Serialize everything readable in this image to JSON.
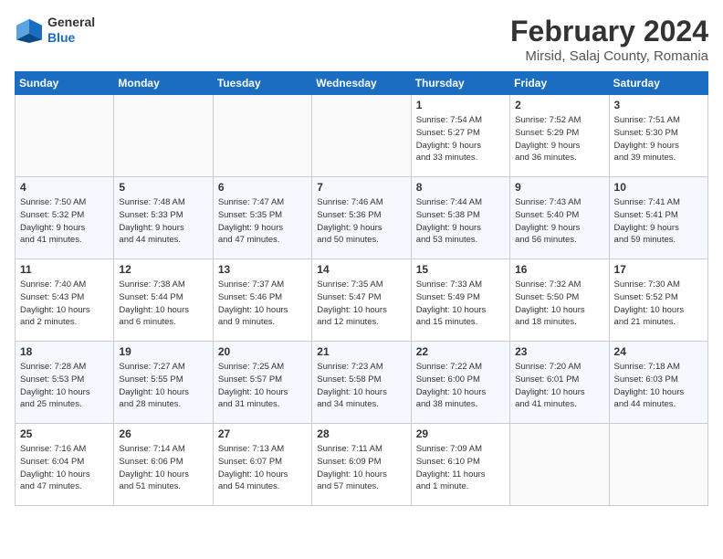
{
  "logo": {
    "general": "General",
    "blue": "Blue"
  },
  "title": "February 2024",
  "subtitle": "Mirsid, Salaj County, Romania",
  "weekdays": [
    "Sunday",
    "Monday",
    "Tuesday",
    "Wednesday",
    "Thursday",
    "Friday",
    "Saturday"
  ],
  "weeks": [
    [
      {
        "day": "",
        "info": ""
      },
      {
        "day": "",
        "info": ""
      },
      {
        "day": "",
        "info": ""
      },
      {
        "day": "",
        "info": ""
      },
      {
        "day": "1",
        "info": "Sunrise: 7:54 AM\nSunset: 5:27 PM\nDaylight: 9 hours\nand 33 minutes."
      },
      {
        "day": "2",
        "info": "Sunrise: 7:52 AM\nSunset: 5:29 PM\nDaylight: 9 hours\nand 36 minutes."
      },
      {
        "day": "3",
        "info": "Sunrise: 7:51 AM\nSunset: 5:30 PM\nDaylight: 9 hours\nand 39 minutes."
      }
    ],
    [
      {
        "day": "4",
        "info": "Sunrise: 7:50 AM\nSunset: 5:32 PM\nDaylight: 9 hours\nand 41 minutes."
      },
      {
        "day": "5",
        "info": "Sunrise: 7:48 AM\nSunset: 5:33 PM\nDaylight: 9 hours\nand 44 minutes."
      },
      {
        "day": "6",
        "info": "Sunrise: 7:47 AM\nSunset: 5:35 PM\nDaylight: 9 hours\nand 47 minutes."
      },
      {
        "day": "7",
        "info": "Sunrise: 7:46 AM\nSunset: 5:36 PM\nDaylight: 9 hours\nand 50 minutes."
      },
      {
        "day": "8",
        "info": "Sunrise: 7:44 AM\nSunset: 5:38 PM\nDaylight: 9 hours\nand 53 minutes."
      },
      {
        "day": "9",
        "info": "Sunrise: 7:43 AM\nSunset: 5:40 PM\nDaylight: 9 hours\nand 56 minutes."
      },
      {
        "day": "10",
        "info": "Sunrise: 7:41 AM\nSunset: 5:41 PM\nDaylight: 9 hours\nand 59 minutes."
      }
    ],
    [
      {
        "day": "11",
        "info": "Sunrise: 7:40 AM\nSunset: 5:43 PM\nDaylight: 10 hours\nand 2 minutes."
      },
      {
        "day": "12",
        "info": "Sunrise: 7:38 AM\nSunset: 5:44 PM\nDaylight: 10 hours\nand 6 minutes."
      },
      {
        "day": "13",
        "info": "Sunrise: 7:37 AM\nSunset: 5:46 PM\nDaylight: 10 hours\nand 9 minutes."
      },
      {
        "day": "14",
        "info": "Sunrise: 7:35 AM\nSunset: 5:47 PM\nDaylight: 10 hours\nand 12 minutes."
      },
      {
        "day": "15",
        "info": "Sunrise: 7:33 AM\nSunset: 5:49 PM\nDaylight: 10 hours\nand 15 minutes."
      },
      {
        "day": "16",
        "info": "Sunrise: 7:32 AM\nSunset: 5:50 PM\nDaylight: 10 hours\nand 18 minutes."
      },
      {
        "day": "17",
        "info": "Sunrise: 7:30 AM\nSunset: 5:52 PM\nDaylight: 10 hours\nand 21 minutes."
      }
    ],
    [
      {
        "day": "18",
        "info": "Sunrise: 7:28 AM\nSunset: 5:53 PM\nDaylight: 10 hours\nand 25 minutes."
      },
      {
        "day": "19",
        "info": "Sunrise: 7:27 AM\nSunset: 5:55 PM\nDaylight: 10 hours\nand 28 minutes."
      },
      {
        "day": "20",
        "info": "Sunrise: 7:25 AM\nSunset: 5:57 PM\nDaylight: 10 hours\nand 31 minutes."
      },
      {
        "day": "21",
        "info": "Sunrise: 7:23 AM\nSunset: 5:58 PM\nDaylight: 10 hours\nand 34 minutes."
      },
      {
        "day": "22",
        "info": "Sunrise: 7:22 AM\nSunset: 6:00 PM\nDaylight: 10 hours\nand 38 minutes."
      },
      {
        "day": "23",
        "info": "Sunrise: 7:20 AM\nSunset: 6:01 PM\nDaylight: 10 hours\nand 41 minutes."
      },
      {
        "day": "24",
        "info": "Sunrise: 7:18 AM\nSunset: 6:03 PM\nDaylight: 10 hours\nand 44 minutes."
      }
    ],
    [
      {
        "day": "25",
        "info": "Sunrise: 7:16 AM\nSunset: 6:04 PM\nDaylight: 10 hours\nand 47 minutes."
      },
      {
        "day": "26",
        "info": "Sunrise: 7:14 AM\nSunset: 6:06 PM\nDaylight: 10 hours\nand 51 minutes."
      },
      {
        "day": "27",
        "info": "Sunrise: 7:13 AM\nSunset: 6:07 PM\nDaylight: 10 hours\nand 54 minutes."
      },
      {
        "day": "28",
        "info": "Sunrise: 7:11 AM\nSunset: 6:09 PM\nDaylight: 10 hours\nand 57 minutes."
      },
      {
        "day": "29",
        "info": "Sunrise: 7:09 AM\nSunset: 6:10 PM\nDaylight: 11 hours\nand 1 minute."
      },
      {
        "day": "",
        "info": ""
      },
      {
        "day": "",
        "info": ""
      }
    ]
  ]
}
